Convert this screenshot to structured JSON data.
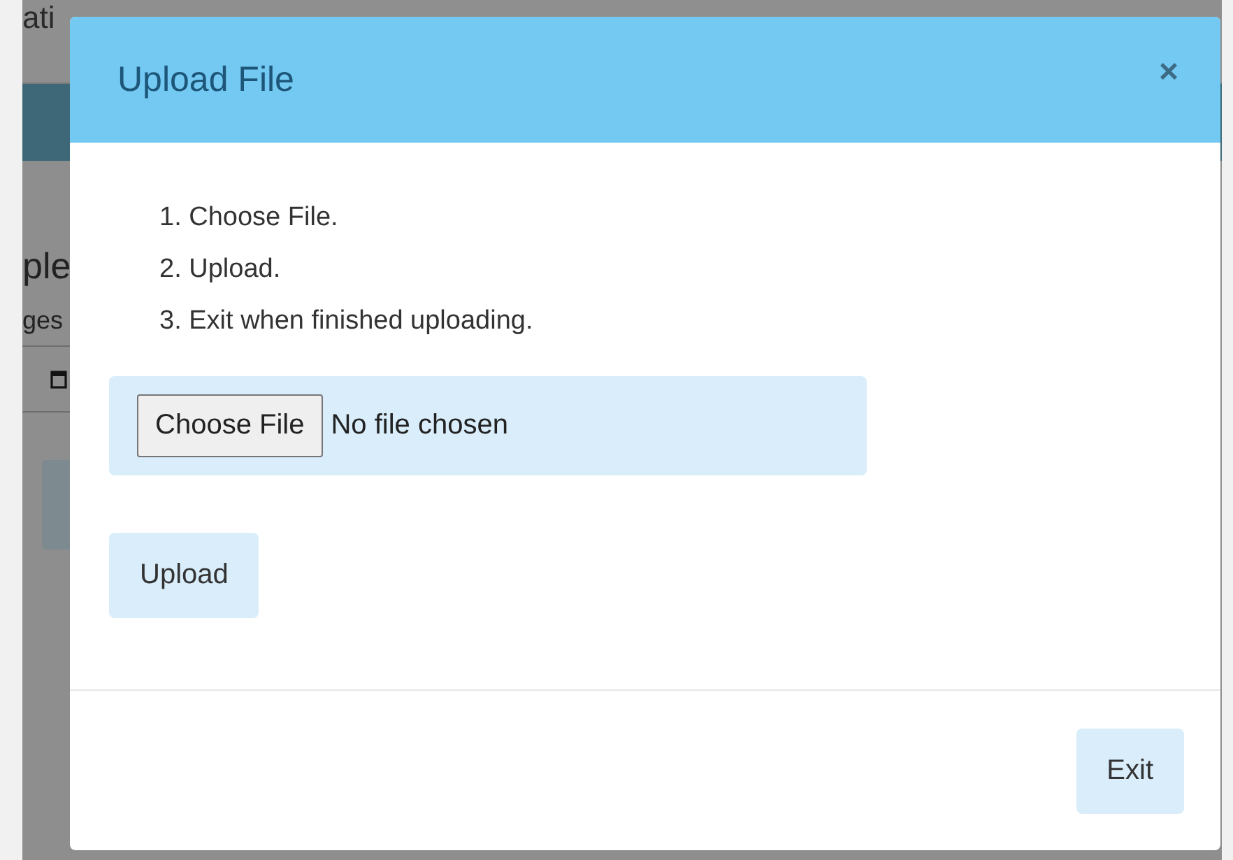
{
  "background": {
    "texts": [
      {
        "kind": "heading",
        "text": "ati"
      },
      {
        "kind": "title",
        "text": "ple"
      },
      {
        "kind": "subtitle",
        "text": "ges"
      }
    ]
  },
  "modal": {
    "title": "Upload File",
    "close": "×",
    "steps": [
      "1. Choose File.",
      "2. Upload.",
      "3. Exit when finished uploading."
    ],
    "file_input": {
      "button": "Choose File",
      "status": "No file chosen"
    },
    "upload_button": "Upload",
    "exit_button": "Exit"
  }
}
